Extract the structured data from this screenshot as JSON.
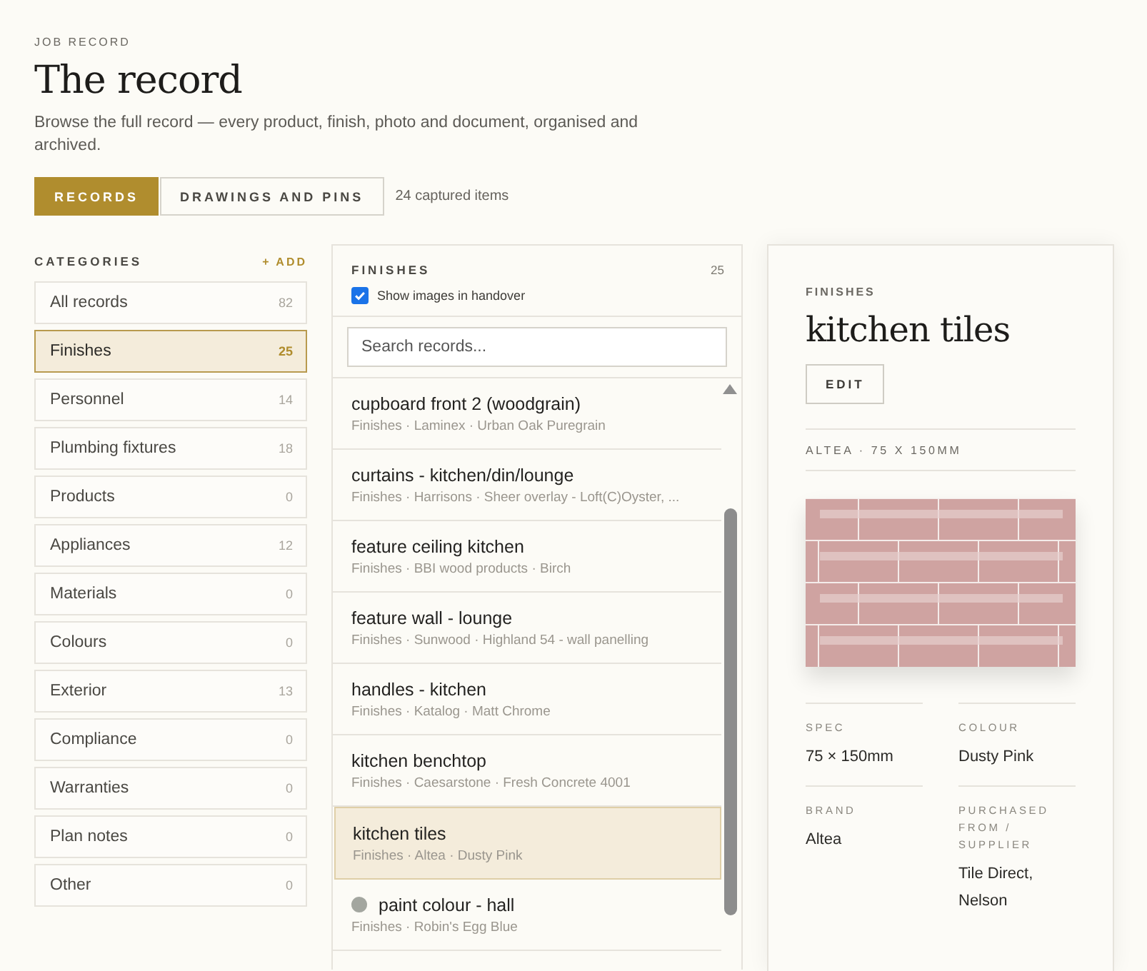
{
  "header": {
    "eyebrow": "JOB RECORD",
    "title": "The record",
    "description": "Browse the full record — every product, finish, photo and document, organised and archived.",
    "view_tabs": [
      {
        "label": "RECORDS",
        "selected": true
      },
      {
        "label": "DRAWINGS AND PINS",
        "selected": false
      }
    ],
    "item_count": "24 captured items"
  },
  "categories": {
    "title": "CATEGORIES",
    "add_label": "+ ADD",
    "items": [
      {
        "label": "All records",
        "count": "82",
        "selected": false
      },
      {
        "label": "Finishes",
        "count": "25",
        "selected": true
      },
      {
        "label": "Personnel",
        "count": "14",
        "selected": false
      },
      {
        "label": "Plumbing fixtures",
        "count": "18",
        "selected": false
      },
      {
        "label": "Products",
        "count": "0",
        "selected": false
      },
      {
        "label": "Appliances",
        "count": "12",
        "selected": false
      },
      {
        "label": "Materials",
        "count": "0",
        "selected": false
      },
      {
        "label": "Colours",
        "count": "0",
        "selected": false
      },
      {
        "label": "Exterior",
        "count": "13",
        "selected": false
      },
      {
        "label": "Compliance",
        "count": "0",
        "selected": false
      },
      {
        "label": "Warranties",
        "count": "0",
        "selected": false
      },
      {
        "label": "Plan notes",
        "count": "0",
        "selected": false
      },
      {
        "label": "Other",
        "count": "0",
        "selected": false
      }
    ]
  },
  "list": {
    "title": "FINISHES",
    "count": "25",
    "show_images": {
      "label": "Show images in handover",
      "checked": true
    },
    "search": {
      "placeholder": "Search records..."
    },
    "records": [
      {
        "title": "cupboard front 2 (woodgrain)",
        "subtitle": "Finishes · Laminex · Urban Oak Puregrain",
        "selected": false
      },
      {
        "title": "curtains - kitchen/din/lounge",
        "subtitle": "Finishes · Harrisons · Sheer overlay - Loft(C)Oyster, ...",
        "selected": false
      },
      {
        "title": "feature ceiling kitchen",
        "subtitle": "Finishes · BBI wood products · Birch",
        "selected": false
      },
      {
        "title": "feature wall - lounge",
        "subtitle": "Finishes · Sunwood · Highland 54 - wall panelling",
        "selected": false
      },
      {
        "title": "handles - kitchen",
        "subtitle": "Finishes · Katalog · Matt Chrome",
        "selected": false
      },
      {
        "title": "kitchen benchtop",
        "subtitle": "Finishes · Caesarstone · Fresh Concrete 4001",
        "selected": false
      },
      {
        "title": "kitchen tiles",
        "subtitle": "Finishes · Altea · Dusty Pink",
        "selected": true
      },
      {
        "title": "paint colour - hall",
        "subtitle": "Finishes · Robin's Egg Blue",
        "selected": false,
        "color": "#a3a69f"
      }
    ]
  },
  "detail": {
    "category": "FINISHES",
    "title": "kitchen tiles",
    "edit_label": "EDIT",
    "summary": "ALTEA · 75 X 150MM",
    "fields": [
      {
        "label": "SPEC",
        "value": "75 × 150mm"
      },
      {
        "label": "COLOUR",
        "value": "Dusty Pink"
      },
      {
        "label": "BRAND",
        "value": "Altea"
      },
      {
        "label": "PURCHASED FROM / SUPPLIER",
        "value": "Tile Direct, Nelson"
      }
    ]
  }
}
